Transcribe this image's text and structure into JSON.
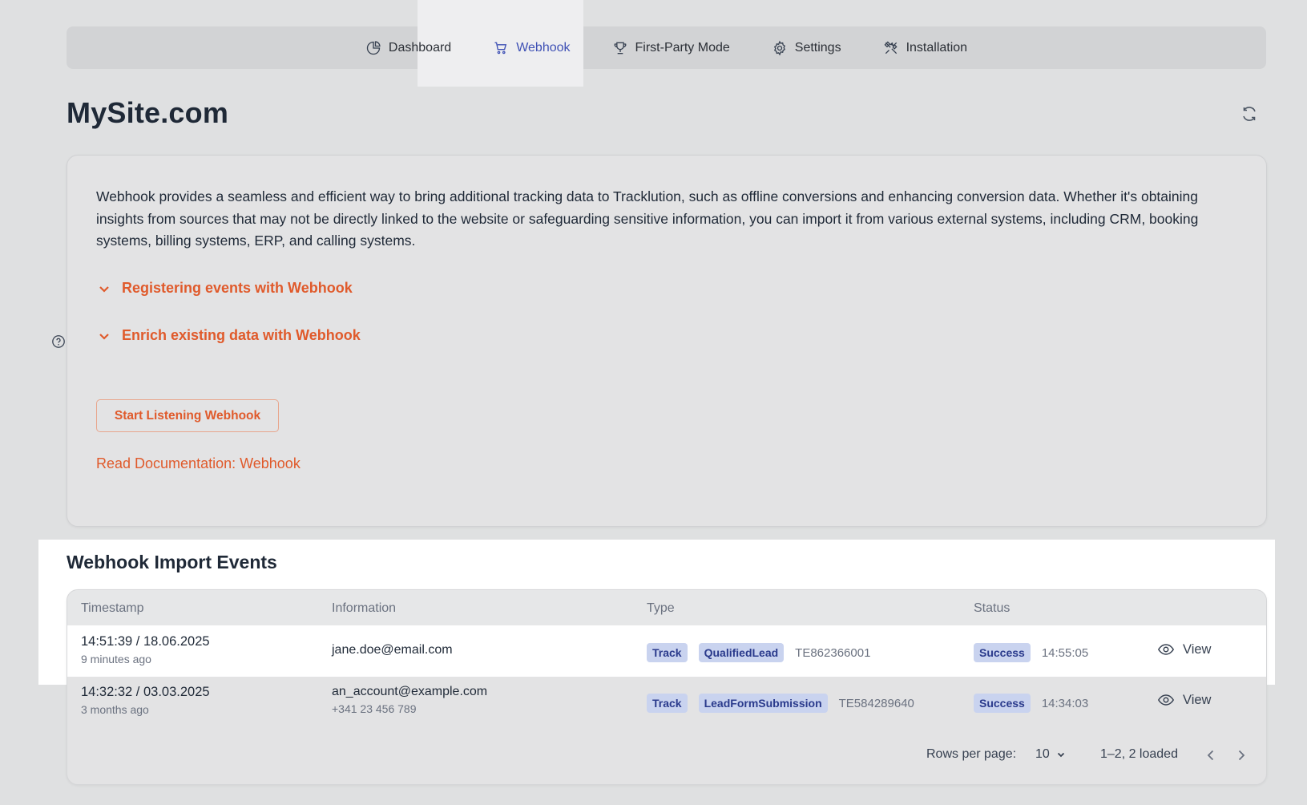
{
  "nav": {
    "items": [
      {
        "label": "Dashboard",
        "icon": "pie-chart-icon"
      },
      {
        "label": "Webhook",
        "icon": "cart-icon",
        "active": true
      },
      {
        "label": "First-Party Mode",
        "icon": "trophy-icon"
      },
      {
        "label": "Settings",
        "icon": "gear-icon"
      },
      {
        "label": "Installation",
        "icon": "tools-icon"
      }
    ]
  },
  "page": {
    "title": "MySite.com"
  },
  "info_card": {
    "intro": "Webhook provides a seamless and efficient way to bring additional tracking data to Tracklution, such as offline conversions and enhancing conversion data. Whether it's obtaining insights from sources that may not be directly linked to the website or safeguarding sensitive information, you can import it from various external systems, including CRM, booking systems, billing systems, ERP, and calling systems.",
    "accordion_1": "Registering events with Webhook",
    "accordion_2": "Enrich existing data with Webhook",
    "start_button": "Start Listening Webhook",
    "doc_link": "Read Documentation: Webhook"
  },
  "events": {
    "title": "Webhook Import Events",
    "columns": {
      "timestamp": "Timestamp",
      "information": "Information",
      "type": "Type",
      "status": "Status"
    },
    "rows": [
      {
        "timestamp": "14:51:39 / 18.06.2025",
        "relative": "9 minutes ago",
        "info_main": "jane.doe@email.com",
        "info_sub": "",
        "badge_1": "Track",
        "badge_2": "QualifiedLead",
        "type_id": "TE862366001",
        "status": "Success",
        "status_time": "14:55:05",
        "view": "View"
      },
      {
        "timestamp": "14:32:32 / 03.03.2025",
        "relative": "3 months ago",
        "info_main": "an_account@example.com",
        "info_sub": "+341 23 456 789",
        "badge_1": "Track",
        "badge_2": "LeadFormSubmission",
        "type_id": "TE584289640",
        "status": "Success",
        "status_time": "14:34:03",
        "view": "View"
      }
    ],
    "pagination": {
      "rows_label": "Rows per page:",
      "rows_value": "10",
      "range": "1–2, 2 loaded"
    }
  },
  "colors": {
    "accent": "#e05a2b",
    "nav_active": "#3f51b5",
    "badge_bg": "#c9d3ef",
    "badge_text": "#2a3a8c"
  }
}
